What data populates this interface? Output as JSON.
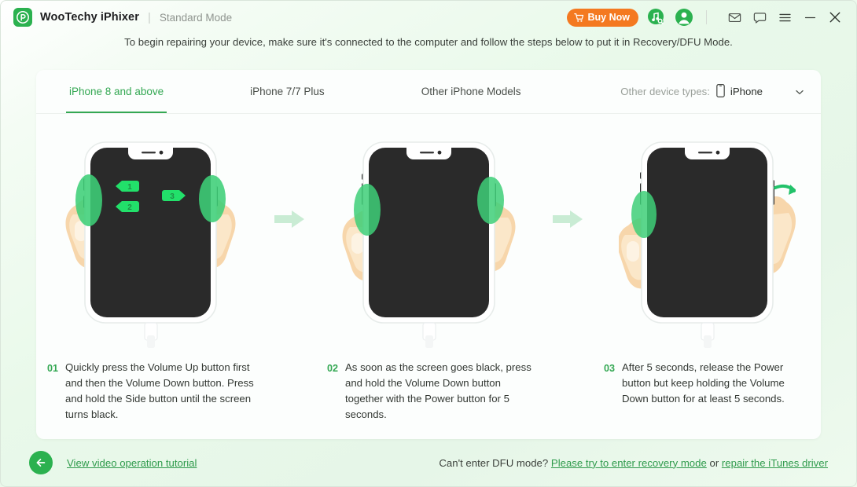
{
  "window": {
    "brand": "WooTechy iPhixer",
    "separator": "|",
    "mode": "Standard Mode",
    "logo_icon": "wootechy-logo-icon",
    "buy_now": "Buy Now",
    "cart_icon": "cart-icon",
    "itunes_icon": "itunes-repair-icon",
    "account_icon": "account-avatar-icon",
    "mail_icon": "mail-icon",
    "feedback_icon": "feedback-chat-icon",
    "menu_icon": "hamburger-menu-icon",
    "minimize_icon": "minimize-icon",
    "close_icon": "close-icon",
    "accent_green": "#2bb14f",
    "buy_orange": "#f47920"
  },
  "hint": "To begin repairing your device, make sure it's connected to the computer and follow the steps below to put it in Recovery/DFU Mode.",
  "tabs": [
    {
      "label": "iPhone 8 and above",
      "active": true
    },
    {
      "label": "iPhone 7/7 Plus",
      "active": false
    },
    {
      "label": "Other iPhone Models",
      "active": false
    }
  ],
  "device_select": {
    "label": "Other device types:",
    "value": "iPhone",
    "device_icon": "iphone-device-icon",
    "caret_icon": "chevron-down-icon"
  },
  "steps": [
    {
      "num": "01",
      "text": "Quickly press the Volume Up button first and then the Volume Down button. Press and hold the Side button until the screen turns black.",
      "illustration": "phone-two-hands-with-badges",
      "badges": [
        "1",
        "2",
        "3"
      ]
    },
    {
      "num": "02",
      "text": "As soon as the screen goes black, press and hold the Volume Down button together with the Power button for 5 seconds.",
      "illustration": "phone-two-hands-holding",
      "badges": []
    },
    {
      "num": "03",
      "text": "After 5 seconds, release the Power button but keep holding the Volume Down button for at least 5 seconds.",
      "illustration": "phone-release-power-button",
      "badges": []
    }
  ],
  "arrow_icon": "arrow-right-icon",
  "footer": {
    "back_icon": "back-arrow-icon",
    "tutorial_link": "View video operation tutorial",
    "question": "Can't enter DFU mode?",
    "link_recovery": "Please try to enter recovery mode",
    "conjunction": "or",
    "link_itunes": "repair the iTunes driver"
  }
}
